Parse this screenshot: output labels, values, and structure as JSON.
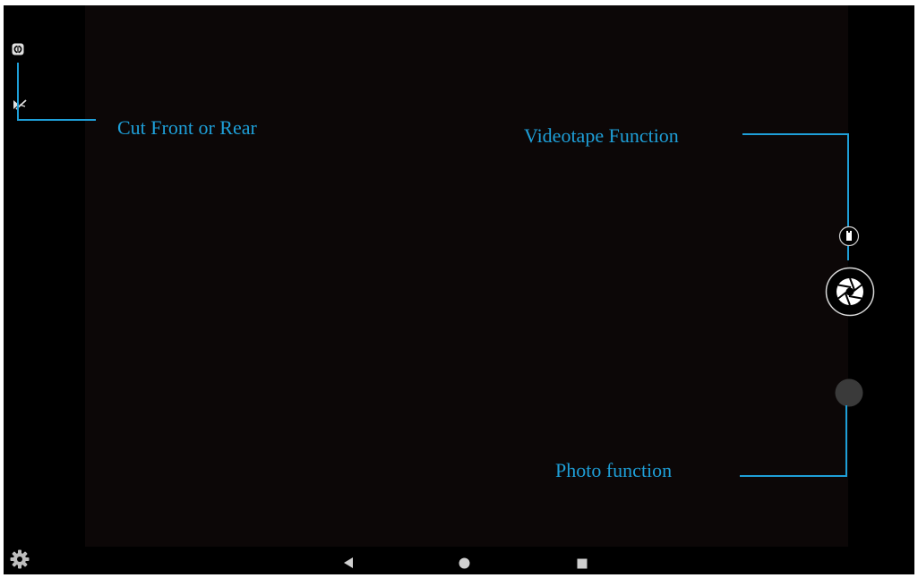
{
  "colors": {
    "accent": "#1e9fd8",
    "screen_background": "#000000",
    "viewfinder": "#0c0707",
    "icon": "#e0e0e0"
  },
  "annotations": {
    "switch_camera": "Cut Front or Rear",
    "video": "Videotape Function",
    "photo": "Photo function"
  },
  "icons": {
    "top_left": "camera-switch-icon",
    "flash": "flash-off-icon",
    "video_mode": "video-mode-icon",
    "shutter": "shutter-aperture-icon",
    "thumbnail": "gallery-thumbnail",
    "settings": "gear-icon",
    "nav_back": "back-triangle-icon",
    "nav_home": "home-circle-icon",
    "nav_recents": "recents-square-icon"
  }
}
